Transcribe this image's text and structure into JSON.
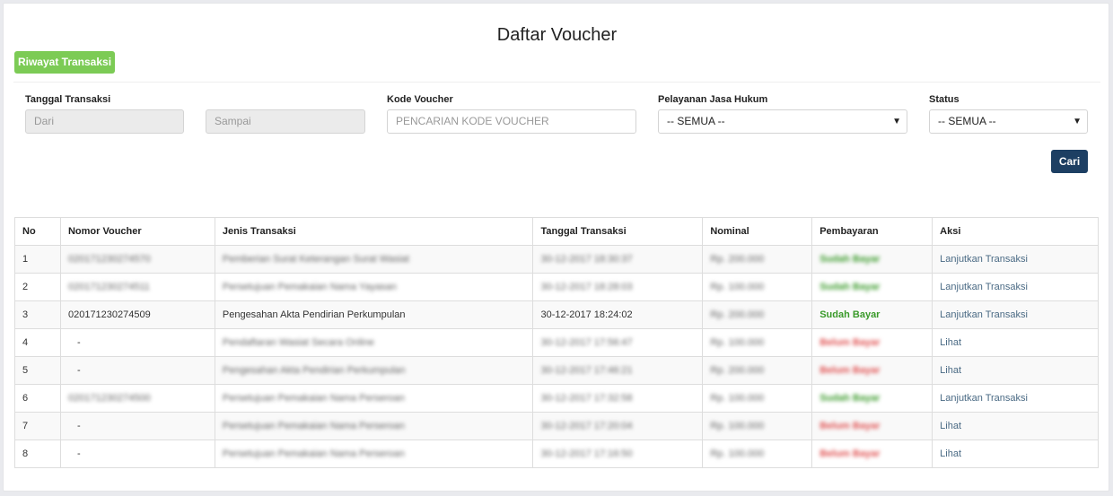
{
  "page": {
    "title": "Daftar Voucher"
  },
  "toolbar": {
    "history_label": "Riwayat Transaksi",
    "search_label": "Cari"
  },
  "filters": {
    "date_label": "Tanggal Transaksi",
    "date_from_placeholder": "Dari",
    "date_to_placeholder": "Sampai",
    "voucher_label": "Kode Voucher",
    "voucher_placeholder": "PENCARIAN KODE VOUCHER",
    "service_label": "Pelayanan Jasa Hukum",
    "service_value": "-- SEMUA --",
    "status_label": "Status",
    "status_value": "-- SEMUA --",
    "caret": "▼"
  },
  "table": {
    "columns": [
      "No",
      "Nomor Voucher",
      "Jenis Transaksi",
      "Tanggal Transaksi",
      "Nominal",
      "Pembayaran",
      "Aksi"
    ],
    "rows": [
      {
        "no": "1",
        "voucher": "020171230274570",
        "type": "Pemberian Surat Keterangan Surat Wasiat",
        "date": "30-12-2017 18:30:37",
        "nominal": "Rp. 200.000",
        "payment": "Sudah Bayar",
        "action": "Lanjutkan Transaksi"
      },
      {
        "no": "2",
        "voucher": "020171230274511",
        "type": "Persetujuan Pemakaian Nama Yayasan",
        "date": "30-12-2017 18:28:03",
        "nominal": "Rp. 100.000",
        "payment": "Sudah Bayar",
        "action": "Lanjutkan Transaksi"
      },
      {
        "no": "3",
        "voucher": "020171230274509",
        "type": "Pengesahan Akta Pendirian Perkumpulan",
        "date": "30-12-2017 18:24:02",
        "nominal": "Rp. 200.000",
        "payment": "Sudah Bayar",
        "action": "Lanjutkan Transaksi"
      },
      {
        "no": "4",
        "voucher": "-",
        "type": "Pendaftaran Wasiat Secara Online",
        "date": "30-12-2017 17:56:47",
        "nominal": "Rp. 100.000",
        "payment": "Belum Bayar",
        "action": "Lihat"
      },
      {
        "no": "5",
        "voucher": "-",
        "type": "Pengesahan Akta Pendirian Perkumpulan",
        "date": "30-12-2017 17:46:21",
        "nominal": "Rp. 200.000",
        "payment": "Belum Bayar",
        "action": "Lihat"
      },
      {
        "no": "6",
        "voucher": "020171230274500",
        "type": "Persetujuan Pemakaian Nama Perseroan",
        "date": "30-12-2017 17:32:58",
        "nominal": "Rp. 100.000",
        "payment": "Sudah Bayar",
        "action": "Lanjutkan Transaksi"
      },
      {
        "no": "7",
        "voucher": "-",
        "type": "Persetujuan Pemakaian Nama Perseroan",
        "date": "30-12-2017 17:20:04",
        "nominal": "Rp. 100.000",
        "payment": "Belum Bayar",
        "action": "Lihat"
      },
      {
        "no": "8",
        "voucher": "-",
        "type": "Persetujuan Pemakaian Nama Perseroan",
        "date": "30-12-2017 17:16:50",
        "nominal": "Rp. 100.000",
        "payment": "Belum Bayar",
        "action": "Lihat"
      }
    ],
    "blurred_rows": [
      true,
      true,
      false,
      true,
      true,
      true,
      true,
      true
    ]
  },
  "colors": {
    "history_button": "#7ccb55",
    "search_button": "#1d3f63",
    "paid": "#3a9a2a",
    "unpaid": "#e05050",
    "action_link": "#4a6a84"
  }
}
